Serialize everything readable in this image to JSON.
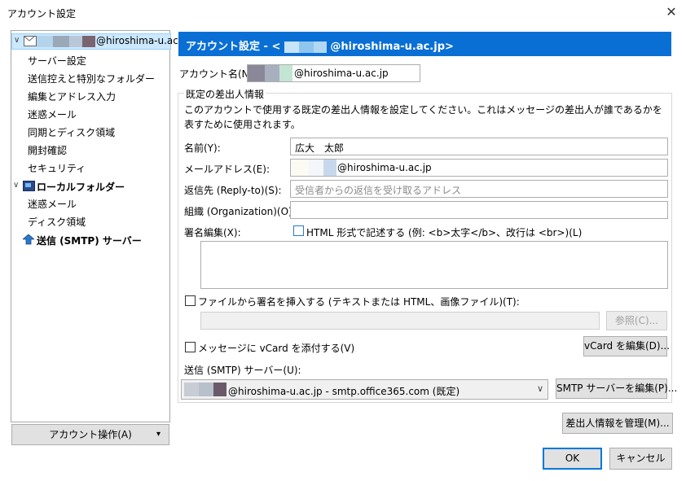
{
  "window": {
    "title": "アカウント設定",
    "close_glyph": "✕"
  },
  "tree": {
    "account_label": "@hiroshima-u.ac.jp",
    "items": [
      "サーバー設定",
      "送信控えと特別なフォルダー",
      "編集とアドレス入力",
      "迷惑メール",
      "同期とディスク領域",
      "開封確認",
      "セキュリティ"
    ],
    "local_folder": "ローカルフォルダー",
    "local_items": [
      "迷惑メール",
      "ディスク領域"
    ],
    "smtp": "送信 (SMTP) サーバー"
  },
  "account_ops_button": {
    "label": "アカウント操作(A)",
    "arrow": "▾"
  },
  "header": {
    "title": "アカウント設定 - <",
    "domain": "@hiroshima-u.ac.jp>"
  },
  "account_name": {
    "label": "アカウント名(N):",
    "value": "@hiroshima-u.ac.jp"
  },
  "identity": {
    "group_title": "既定の差出人情報",
    "description": "このアカウントで使用する既定の差出人情報を設定してください。これはメッセージの差出人が誰であるかを表すために使用されます。",
    "name_label": "名前(Y):",
    "name_value": "広大　太郎",
    "email_label": "メールアドレス(E):",
    "email_value": "@hiroshima-u.ac.jp",
    "replyto_label": "返信先 (Reply-to)(S):",
    "replyto_placeholder": "受信者からの返信を受け取るアドレス",
    "org_label": "組織 (Organization)(O):",
    "org_value": "",
    "sig_label": "署名編集(X):",
    "html_checkbox_label": "HTML 形式で記述する (例: <b>太字</b>、改行は <br>)(L)",
    "file_sig_label": "ファイルから署名を挿入する (テキストまたは HTML、画像ファイル)(T):",
    "browse_button": "参照(C)...",
    "vcard_checkbox_label": "メッセージに vCard を添付する(V)",
    "vcard_edit_button": "vCard を編集(D)...",
    "smtp_label": "送信 (SMTP) サーバー(U):",
    "smtp_value": "@hiroshima-u.ac.jp - smtp.office365.com (既定)",
    "smtp_edit_button": "SMTP サーバーを編集(P)...",
    "manage_identities_button": "差出人情報を管理(M)..."
  },
  "footer": {
    "ok": "OK",
    "cancel": "キャンセル"
  },
  "colors": {
    "header_bg": "#0a6fd4",
    "selection": "#cce8ff",
    "redaction": "#6b5a6a"
  }
}
